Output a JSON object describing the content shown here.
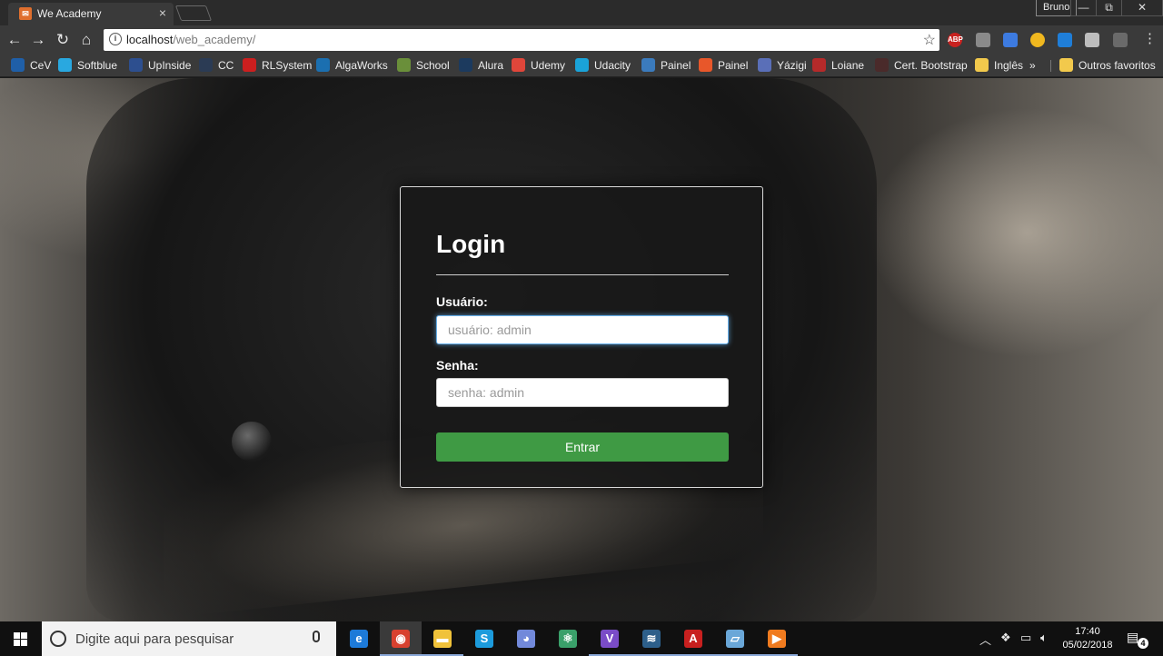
{
  "browser": {
    "tab_title": "We Academy",
    "tab_close": "×",
    "user": "Bruno",
    "window_buttons": [
      "—",
      "⧉",
      "✕"
    ],
    "url_host": "localhost",
    "url_path": "/web_academy/"
  },
  "bookmarks": [
    {
      "label": "CeV",
      "color": "#1f5fa8"
    },
    {
      "label": "Softblue",
      "color": "#29a8e0"
    },
    {
      "label": "UpInside",
      "color": "#2d4f8f"
    },
    {
      "label": "CC",
      "color": "#2b3b54"
    },
    {
      "label": "RLSystem",
      "color": "#cc1f1f"
    },
    {
      "label": "AlgaWorks",
      "color": "#1b6fb0"
    },
    {
      "label": "School",
      "color": "#6a8f3a"
    },
    {
      "label": "Alura",
      "color": "#1c3a5e"
    },
    {
      "label": "Udemy",
      "color": "#e0463a"
    },
    {
      "label": "Udacity",
      "color": "#1aa3d9"
    },
    {
      "label": "Painel",
      "color": "#3b7bbd"
    },
    {
      "label": "Painel",
      "color": "#e8572a"
    },
    {
      "label": "Yázigi",
      "color": "#5a6fb8"
    },
    {
      "label": "Loiane",
      "color": "#b52a2a"
    },
    {
      "label": "Cert. Bootstrap",
      "color": "#4a2a2a"
    },
    {
      "label": "Inglês",
      "color": "#f2c94c"
    },
    {
      "label": "»",
      "color": ""
    },
    {
      "label": "Outros favoritos",
      "color": "#f2c94c"
    }
  ],
  "extensions": [
    {
      "name": "adblock-plus-icon",
      "label": "ABP",
      "color": "#c8211f"
    },
    {
      "name": "shield-extension-icon",
      "label": "",
      "color": "#8a8a8a"
    },
    {
      "name": "translate-icon",
      "label": "",
      "color": "#3d7be0"
    },
    {
      "name": "coin-icon",
      "label": "",
      "color": "#f0b81f"
    },
    {
      "name": "trello-icon",
      "label": "",
      "color": "#1f7ed8"
    },
    {
      "name": "chrome-extension-icon",
      "label": "",
      "color": "#bdbdbd"
    },
    {
      "name": "pdf-icon",
      "label": "",
      "color": "#6a6a6a"
    }
  ],
  "login": {
    "title": "Login",
    "user_label": "Usuário:",
    "user_placeholder": "usuário: admin",
    "password_label": "Senha:",
    "password_placeholder": "senha: admin",
    "submit_label": "Entrar"
  },
  "taskbar": {
    "search_placeholder": "Digite aqui para pesquisar",
    "apps": [
      {
        "name": "edge-icon",
        "color": "#1d7ad8",
        "glyph": "e"
      },
      {
        "name": "chrome-icon",
        "color": "#d8412f",
        "glyph": "◉"
      },
      {
        "name": "file-explorer-icon",
        "color": "#f0c23a",
        "glyph": "▬"
      },
      {
        "name": "skype-icon",
        "color": "#1c9bdc",
        "glyph": "S"
      },
      {
        "name": "discord-icon",
        "color": "#7289da",
        "glyph": "◕"
      },
      {
        "name": "atom-icon",
        "color": "#3aa06a",
        "glyph": "⚛"
      },
      {
        "name": "visual-studio-icon",
        "color": "#7a4cc7",
        "glyph": "V"
      },
      {
        "name": "mysql-workbench-icon",
        "color": "#2d5f8a",
        "glyph": "≋"
      },
      {
        "name": "acrobat-icon",
        "color": "#c8201f",
        "glyph": "A"
      },
      {
        "name": "notes-icon",
        "color": "#6aa7d8",
        "glyph": "▱"
      },
      {
        "name": "media-player-icon",
        "color": "#f07b1f",
        "glyph": "▶"
      }
    ],
    "time": "17:40",
    "date": "05/02/2018",
    "notification_count": "4"
  }
}
